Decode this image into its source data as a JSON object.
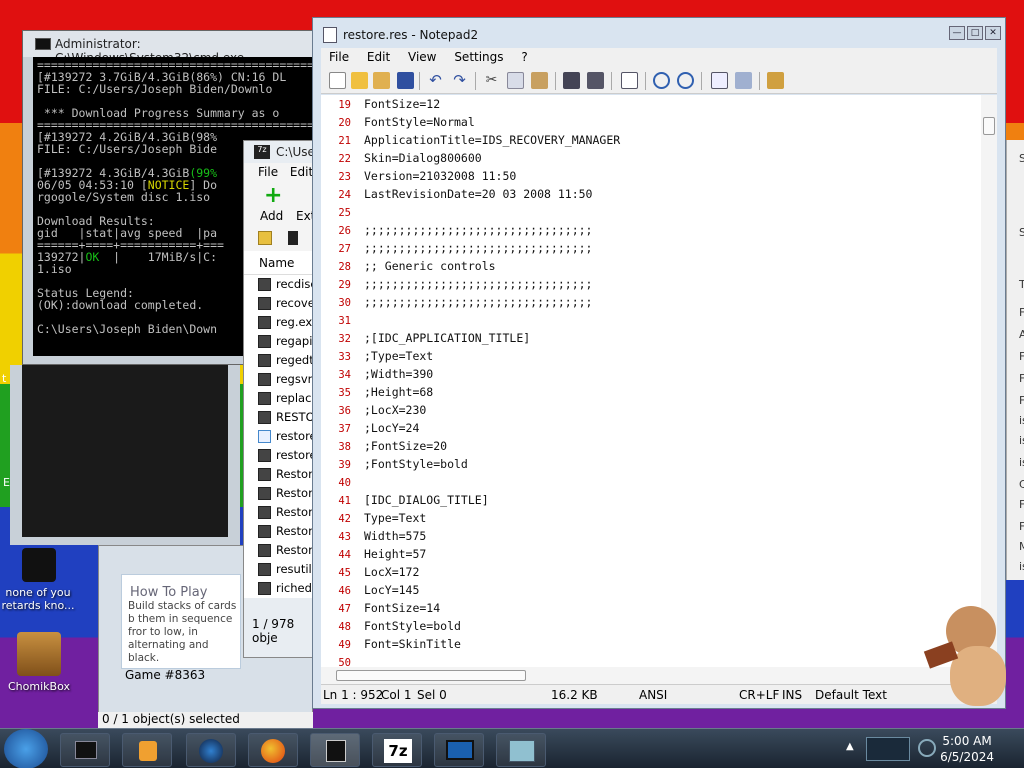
{
  "desktop": {
    "icons": [
      {
        "label": "none of you retards kno..."
      },
      {
        "label": "ChomikBox"
      }
    ],
    "left_letters": [
      "t",
      "E"
    ]
  },
  "cmd": {
    "title": "Administrator: C:\\Windows\\System32\\cmd.exe",
    "lines": [
      "===========================================",
      "[#139272 3.7GiB/4.3GiB(86%) CN:16 DL",
      "FILE: C:/Users/Joseph Biden/Downlo",
      "",
      " *** Download Progress Summary as o",
      "===========================================",
      "[#139272 4.2GiB/4.3GiB(98%",
      "FILE: C:/Users/Joseph Bide",
      "",
      "[#139272 4.3GiB/4.3GiB(99%",
      "06/05 04:53:10 [NOTICE] Do",
      "rgogole/System disc 1.iso",
      "",
      "Download Results:",
      "gid   |stat|avg speed  |pa",
      "======+====+===========+===",
      "139272|OK  |    17MiB/s|C:",
      "1.iso",
      "",
      "Status Legend:",
      "(OK):download completed.",
      "",
      "C:\\Users\\Joseph Biden\\Down"
    ]
  },
  "zip": {
    "title": "C:\\User",
    "menu": [
      "File",
      "Edit"
    ],
    "toolbar": [
      "Add",
      "Ext"
    ],
    "column_header": "Name",
    "files": [
      "recdisc",
      "recover",
      "reg.exe",
      "regapi.",
      "regedt3",
      "regsvr3",
      "replace",
      "RESTOR",
      "restore",
      "restore",
      "Restore",
      "Restore",
      "Restore",
      "Restore",
      "Restore",
      "resutils",
      "riched2"
    ],
    "status": "1 / 978 obje"
  },
  "solitaire": {
    "heading": "How To Play",
    "text": "Build stacks of cards b them in sequence fror to low, in alternating and black.",
    "game": "Game #8363",
    "status": "0 / 1 object(s) selected"
  },
  "right_window": {
    "items": [
      "Se",
      "Si",
      "T",
      "F",
      "A",
      "F",
      "F",
      "F",
      "is",
      "is",
      "is",
      "C",
      "F",
      "F",
      "M",
      "is"
    ]
  },
  "notepad": {
    "title": "restore.res - Notepad2",
    "menu": [
      "File",
      "Edit",
      "View",
      "Settings",
      "?"
    ],
    "lines": [
      {
        "n": "19",
        "t": "FontSize=12"
      },
      {
        "n": "20",
        "t": "FontStyle=Normal"
      },
      {
        "n": "21",
        "t": "ApplicationTitle=IDS_RECOVERY_MANAGER"
      },
      {
        "n": "22",
        "t": "Skin=Dialog800600"
      },
      {
        "n": "23",
        "t": "Version=21032008 11:50"
      },
      {
        "n": "24",
        "t": "LastRevisionDate=20 03 2008 11:50"
      },
      {
        "n": "25",
        "t": ""
      },
      {
        "n": "26",
        "t": ";;;;;;;;;;;;;;;;;;;;;;;;;;;;;;;;;"
      },
      {
        "n": "27",
        "t": ";;;;;;;;;;;;;;;;;;;;;;;;;;;;;;;;;"
      },
      {
        "n": "28",
        "t": ";; Generic controls"
      },
      {
        "n": "29",
        "t": ";;;;;;;;;;;;;;;;;;;;;;;;;;;;;;;;;"
      },
      {
        "n": "30",
        "t": ";;;;;;;;;;;;;;;;;;;;;;;;;;;;;;;;;"
      },
      {
        "n": "31",
        "t": ""
      },
      {
        "n": "32",
        "t": ";[IDC_APPLICATION_TITLE]"
      },
      {
        "n": "33",
        "t": ";Type=Text"
      },
      {
        "n": "34",
        "t": ";Width=390"
      },
      {
        "n": "35",
        "t": ";Height=68"
      },
      {
        "n": "36",
        "t": ";LocX=230"
      },
      {
        "n": "37",
        "t": ";LocY=24"
      },
      {
        "n": "38",
        "t": ";FontSize=20"
      },
      {
        "n": "39",
        "t": ";FontStyle=bold"
      },
      {
        "n": "40",
        "t": ""
      },
      {
        "n": "41",
        "t": "[IDC_DIALOG_TITLE]"
      },
      {
        "n": "42",
        "t": "Type=Text"
      },
      {
        "n": "43",
        "t": "Width=575"
      },
      {
        "n": "44",
        "t": "Height=57"
      },
      {
        "n": "45",
        "t": "LocX=172"
      },
      {
        "n": "46",
        "t": "LocY=145"
      },
      {
        "n": "47",
        "t": "FontSize=14"
      },
      {
        "n": "48",
        "t": "FontStyle=bold"
      },
      {
        "n": "49",
        "t": "Font=SkinTitle"
      },
      {
        "n": "50",
        "t": ""
      }
    ],
    "status": {
      "position": "Ln 1 : 952",
      "col": "Col 1",
      "sel": "Sel 0",
      "size": "16.2 KB",
      "encoding": "ANSI",
      "eol": "CR+LF",
      "mode": "INS",
      "scheme": "Default Text"
    }
  },
  "taskbar": {
    "time": "5:00 AM",
    "date": "6/5/2024",
    "seven_zip_label": "7z"
  }
}
